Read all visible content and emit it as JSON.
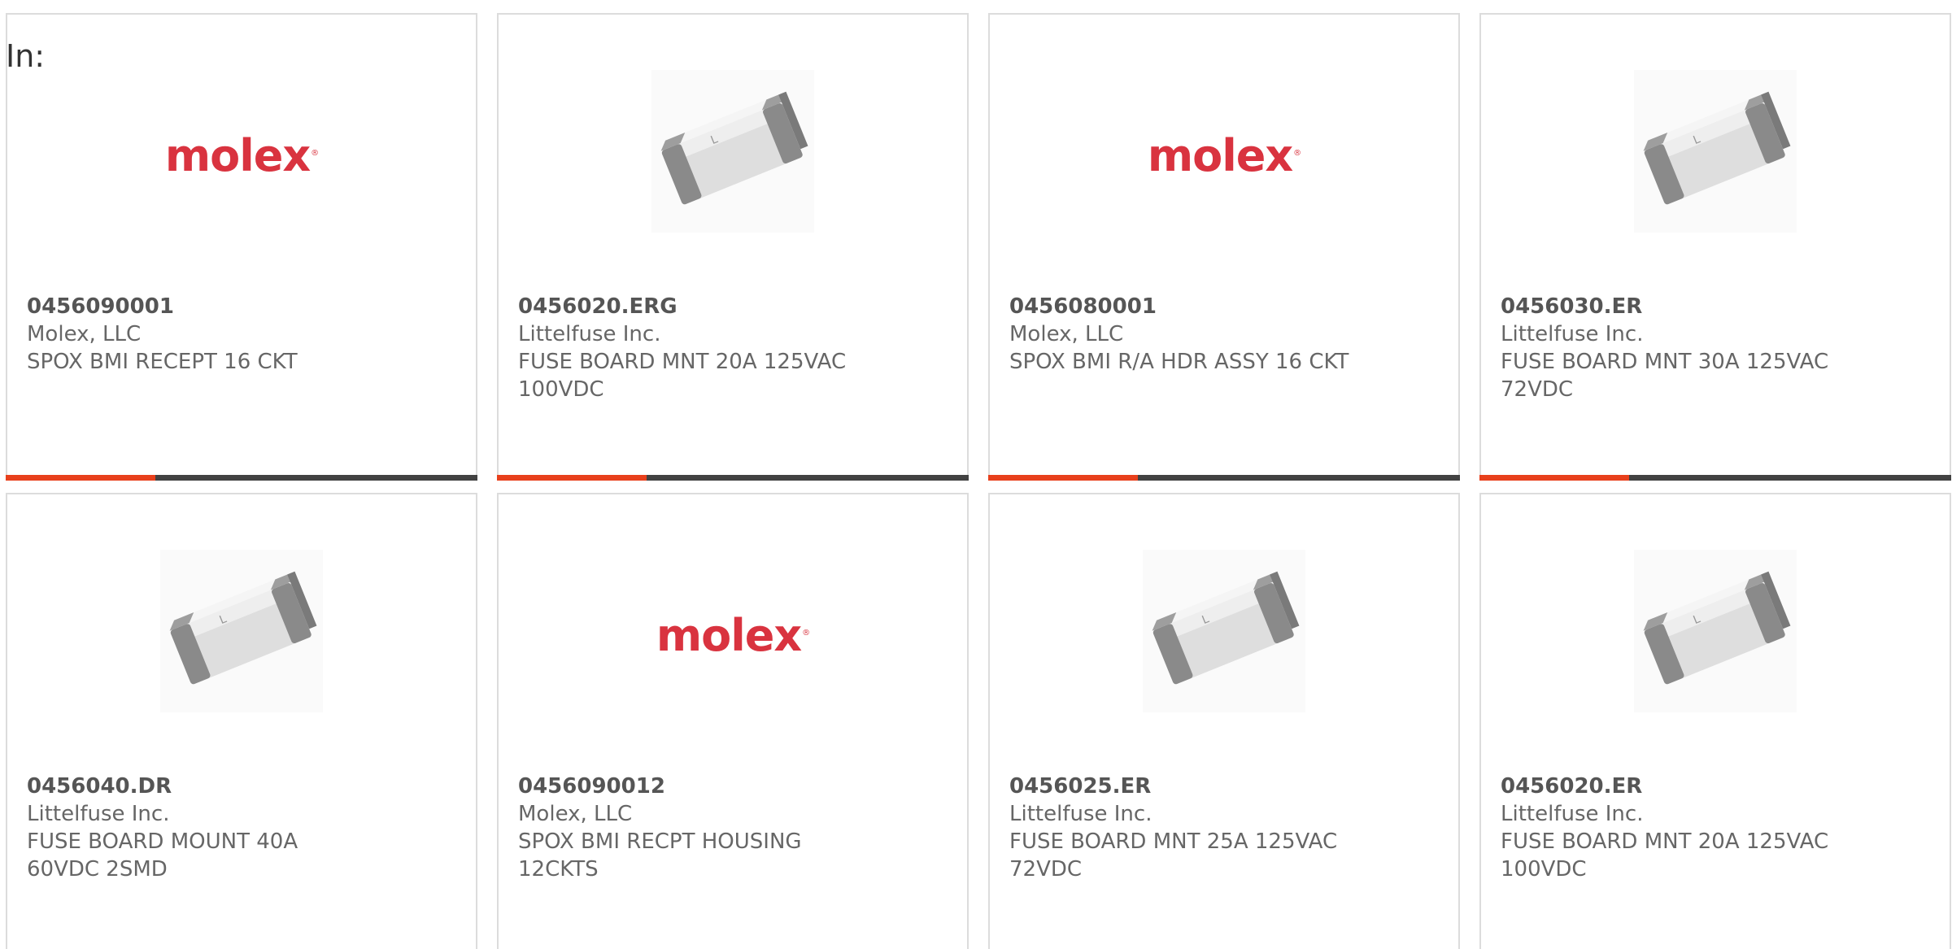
{
  "filter_label": "In:",
  "colors": {
    "accent": "#e8401c",
    "bar": "#424242",
    "molex_red": "#d9333f"
  },
  "products": [
    {
      "part_number": "0456090001",
      "manufacturer": "Molex, LLC",
      "description": "SPOX BMI RECEPT 16 CKT",
      "image": "molex-logo",
      "logo_text": "molex"
    },
    {
      "part_number": "0456020.ERG",
      "manufacturer": "Littelfuse Inc.",
      "description": "FUSE BOARD MNT 20A 125VAC 100VDC",
      "image": "fuse-image"
    },
    {
      "part_number": "0456080001",
      "manufacturer": "Molex, LLC",
      "description": "SPOX BMI R/A HDR ASSY 16 CKT",
      "image": "molex-logo",
      "logo_text": "molex"
    },
    {
      "part_number": "0456030.ER",
      "manufacturer": "Littelfuse Inc.",
      "description": "FUSE BOARD MNT 30A 125VAC 72VDC",
      "image": "fuse-image"
    },
    {
      "part_number": "0456040.DR",
      "manufacturer": "Littelfuse Inc.",
      "description": "FUSE BOARD MOUNT 40A 60VDC 2SMD",
      "image": "fuse-image"
    },
    {
      "part_number": "0456090012",
      "manufacturer": "Molex, LLC",
      "description": "SPOX BMI RECPT HOUSING 12CKTS",
      "image": "molex-logo",
      "logo_text": "molex"
    },
    {
      "part_number": "0456025.ER",
      "manufacturer": "Littelfuse Inc.",
      "description": "FUSE BOARD MNT 25A 125VAC 72VDC",
      "image": "fuse-image"
    },
    {
      "part_number": "0456020.ER",
      "manufacturer": "Littelfuse Inc.",
      "description": "FUSE BOARD MNT 20A 125VAC 100VDC",
      "image": "fuse-image"
    }
  ]
}
